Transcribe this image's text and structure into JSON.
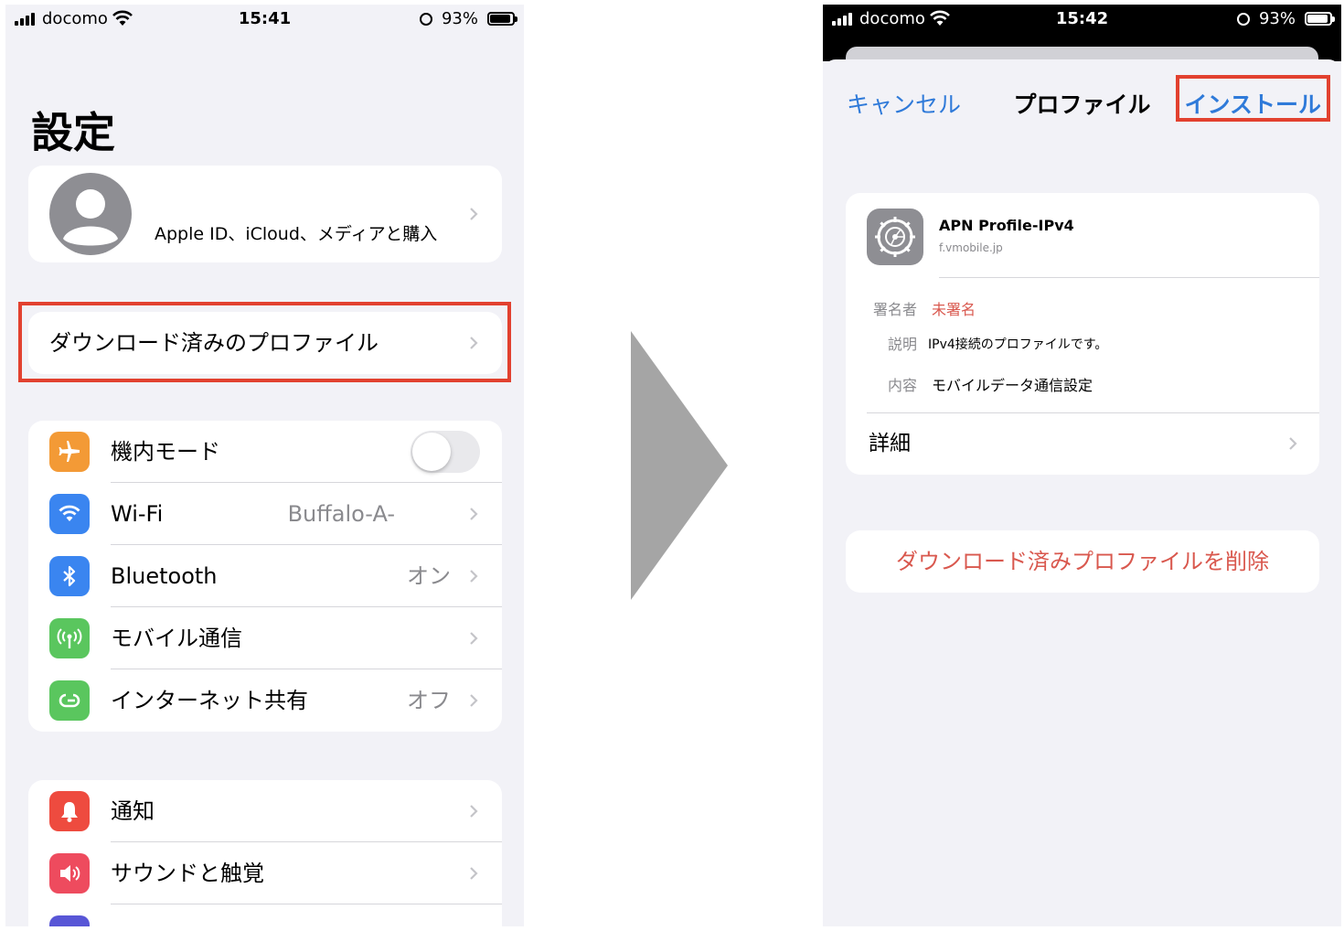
{
  "left_screen": {
    "status": {
      "carrier": "docomo",
      "time": "15:41",
      "battery": "93%",
      "battery_level": 0.93
    },
    "title": "設定",
    "apple_id": {
      "label": "Apple ID、iCloud、メディアと購入"
    },
    "downloaded_profile": {
      "label": "ダウンロード済みのプロファイル"
    },
    "connectivity": [
      {
        "label": "機内モード",
        "value": "",
        "icon": "airplane-icon",
        "color": "#f39a36"
      },
      {
        "label": "Wi-Fi",
        "value": "Buffalo-A-",
        "icon": "wifi-icon",
        "color": "#3a85f0"
      },
      {
        "label": "Bluetooth",
        "value": "オン",
        "icon": "bluetooth-icon",
        "color": "#3a85f0"
      },
      {
        "label": "モバイル通信",
        "value": "",
        "icon": "antenna-icon",
        "color": "#5ac65e"
      },
      {
        "label": "インターネット共有",
        "value": "オフ",
        "icon": "hotspot-icon",
        "color": "#5ac65e"
      }
    ],
    "notifications": [
      {
        "label": "通知",
        "icon": "bell-icon",
        "color": "#ee4b3f"
      },
      {
        "label": "サウンドと触覚",
        "icon": "speaker-icon",
        "color": "#ee4b5e"
      }
    ]
  },
  "right_screen": {
    "status": {
      "carrier": "docomo",
      "time": "15:42",
      "battery": "93%",
      "battery_level": 0.93
    },
    "nav": {
      "cancel": "キャンセル",
      "title": "プロファイル",
      "install": "インストール"
    },
    "profile": {
      "name": "APN Profile-IPv4",
      "domain": "f.vmobile.jp",
      "signed_by_label": "署名者",
      "signed_by_value": "未署名",
      "description_label": "説明",
      "description_value": "IPv4接続のプロファイルです。",
      "contents_label": "内容",
      "contents_value": "モバイルデータ通信設定",
      "details": "詳細"
    },
    "delete_button": "ダウンロード済みプロファイルを削除"
  },
  "colors": {
    "accent": "#2f7ad9",
    "destructive": "#d9584e",
    "highlight": "#e2412f",
    "arrow": "#a5a5a5"
  }
}
